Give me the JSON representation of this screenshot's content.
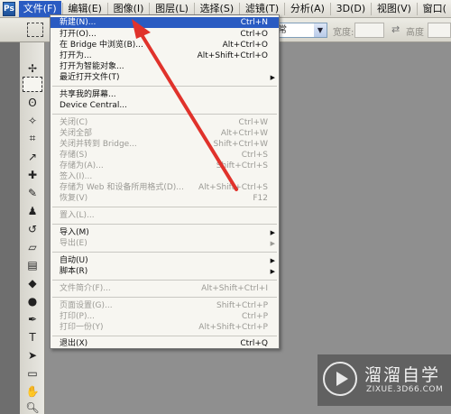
{
  "app": {
    "logo": "Ps"
  },
  "menubar": {
    "items": [
      {
        "label": "文件(F)"
      },
      {
        "label": "编辑(E)"
      },
      {
        "label": "图像(I)"
      },
      {
        "label": "图层(L)"
      },
      {
        "label": "选择(S)"
      },
      {
        "label": "滤镜(T)"
      },
      {
        "label": "分析(A)"
      },
      {
        "label": "3D(D)"
      },
      {
        "label": "视图(V)"
      },
      {
        "label": "窗口("
      }
    ]
  },
  "options": {
    "style_value": "常",
    "width_label": "宽度:",
    "height_label": "高度"
  },
  "file_menu": {
    "items": [
      {
        "label": "新建(N)...",
        "shortcut": "Ctrl+N",
        "disabled": false,
        "highlight": true
      },
      {
        "label": "打开(O)...",
        "shortcut": "Ctrl+O",
        "disabled": false
      },
      {
        "label": "在 Bridge 中浏览(B)...",
        "shortcut": "Alt+Ctrl+O",
        "disabled": false
      },
      {
        "label": "打开为...",
        "shortcut": "Alt+Shift+Ctrl+O",
        "disabled": false
      },
      {
        "label": "打开为智能对象...",
        "shortcut": "",
        "disabled": false
      },
      {
        "label": "最近打开文件(T)",
        "shortcut": "",
        "disabled": false,
        "submenu": true
      },
      {
        "label": "共享我的屏幕...",
        "shortcut": "",
        "disabled": false
      },
      {
        "label": "Device Central...",
        "shortcut": "",
        "disabled": false
      },
      {
        "label": "关闭(C)",
        "shortcut": "Ctrl+W",
        "disabled": true
      },
      {
        "label": "关闭全部",
        "shortcut": "Alt+Ctrl+W",
        "disabled": true
      },
      {
        "label": "关闭并转到 Bridge...",
        "shortcut": "Shift+Ctrl+W",
        "disabled": true
      },
      {
        "label": "存储(S)",
        "shortcut": "Ctrl+S",
        "disabled": true
      },
      {
        "label": "存储为(A)...",
        "shortcut": "Shift+Ctrl+S",
        "disabled": true
      },
      {
        "label": "签入(I)...",
        "shortcut": "",
        "disabled": true
      },
      {
        "label": "存储为 Web 和设备所用格式(D)...",
        "shortcut": "Alt+Shift+Ctrl+S",
        "disabled": true
      },
      {
        "label": "恢复(V)",
        "shortcut": "F12",
        "disabled": true
      },
      {
        "label": "置入(L)...",
        "shortcut": "",
        "disabled": true
      },
      {
        "label": "导入(M)",
        "shortcut": "",
        "disabled": false,
        "submenu": true
      },
      {
        "label": "导出(E)",
        "shortcut": "",
        "disabled": true,
        "submenu": true
      },
      {
        "label": "自动(U)",
        "shortcut": "",
        "disabled": false,
        "submenu": true
      },
      {
        "label": "脚本(R)",
        "shortcut": "",
        "disabled": false,
        "submenu": true
      },
      {
        "label": "文件简介(F)...",
        "shortcut": "Alt+Shift+Ctrl+I",
        "disabled": true
      },
      {
        "label": "页面设置(G)...",
        "shortcut": "Shift+Ctrl+P",
        "disabled": true
      },
      {
        "label": "打印(P)...",
        "shortcut": "Ctrl+P",
        "disabled": true
      },
      {
        "label": "打印一份(Y)",
        "shortcut": "Alt+Shift+Ctrl+P",
        "disabled": true
      },
      {
        "label": "退出(X)",
        "shortcut": "Ctrl+Q",
        "disabled": false
      }
    ]
  },
  "watermark": {
    "title": "溜溜自学",
    "url": "ZIXUE.3D66.COM"
  },
  "colors": {
    "highlight": "#2a5bc2",
    "arrow": "#e0322b"
  }
}
